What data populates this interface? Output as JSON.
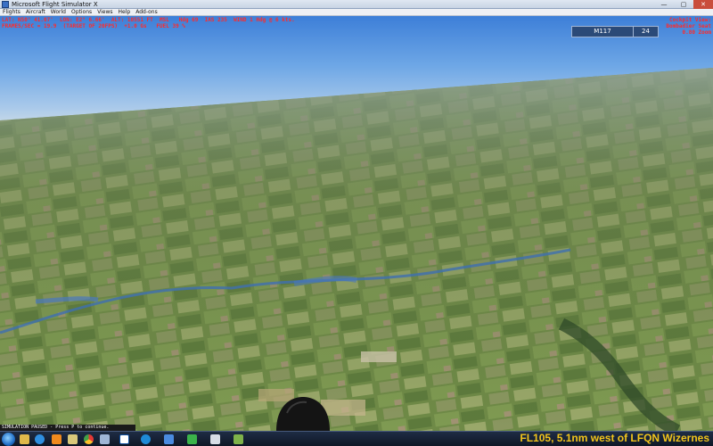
{
  "window": {
    "title": "Microsoft Flight Simulator X",
    "buttons": [
      "—",
      "▢",
      "✕"
    ]
  },
  "menu": [
    "Flights",
    "Aircraft",
    "World",
    "Options",
    "Views",
    "Help",
    "Add-ons"
  ],
  "hud": {
    "line1": "LAT: N50° 41.07'  LON: E2° 6.66'  ALT: 10551 FT  MSL   Hdg 69  IAS 235  WIND 1 Hdg @ 6 kts.",
    "line2": "FRAMES/SEC = 19.9  (TARGET OF 20FPS)  +1.0 Gs   FUEL 39 %"
  },
  "cockpit_view": [
    "Cockpit View:",
    "Bombadier Seat",
    "0.80 Zoom"
  ],
  "radio": {
    "frequency": "M117",
    "channel": "24"
  },
  "sim_status": "SIMULATION PAUSED - Press P to continue.",
  "location_status": "FL105, 5.1nm west of LFQN Wizernes",
  "taskbar": {
    "icons": [
      "start-orb-icon",
      "folder-icon",
      "ie-icon",
      "media-player-icon",
      "explorer-icon",
      "chrome-icon",
      "app-icon",
      "n-icon",
      "edge-icon",
      "fsx-plane-icon",
      "app-green-icon",
      "window-icon",
      "photo-icon"
    ]
  },
  "colors": {
    "hud_red": "#ff2a2a",
    "status_yellow": "#f3c51b",
    "radio_bg": "#2b4a78"
  }
}
